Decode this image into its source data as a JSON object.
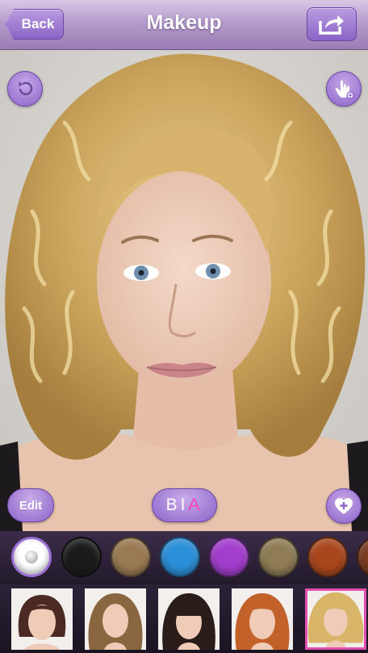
{
  "header": {
    "title": "Makeup",
    "back_label": "Back"
  },
  "controls": {
    "edit_label": "Edit",
    "bia_b": "B",
    "bia_i": "I",
    "bia_a": "A"
  },
  "hair_colors": [
    {
      "name": "selected-none",
      "color": "#ffffff"
    },
    {
      "name": "black",
      "color": "#1b1b1b"
    },
    {
      "name": "light-brown",
      "color": "#9a7a52"
    },
    {
      "name": "blue",
      "color": "#2b8fd8"
    },
    {
      "name": "purple",
      "color": "#a23dcc"
    },
    {
      "name": "ash-blonde",
      "color": "#8f7c55"
    },
    {
      "name": "copper",
      "color": "#a8461c"
    },
    {
      "name": "auburn",
      "color": "#7a3a22"
    }
  ],
  "hairstyles": [
    {
      "name": "dark-bob",
      "hair": "#4a2a22"
    },
    {
      "name": "light-brown-waves",
      "hair": "#8a6640"
    },
    {
      "name": "dark-long-bangs",
      "hair": "#2a1c18"
    },
    {
      "name": "copper-waves",
      "hair": "#c2622a"
    },
    {
      "name": "blonde-curls",
      "hair": "#d9b56a"
    }
  ],
  "accent": "#8d63c9"
}
